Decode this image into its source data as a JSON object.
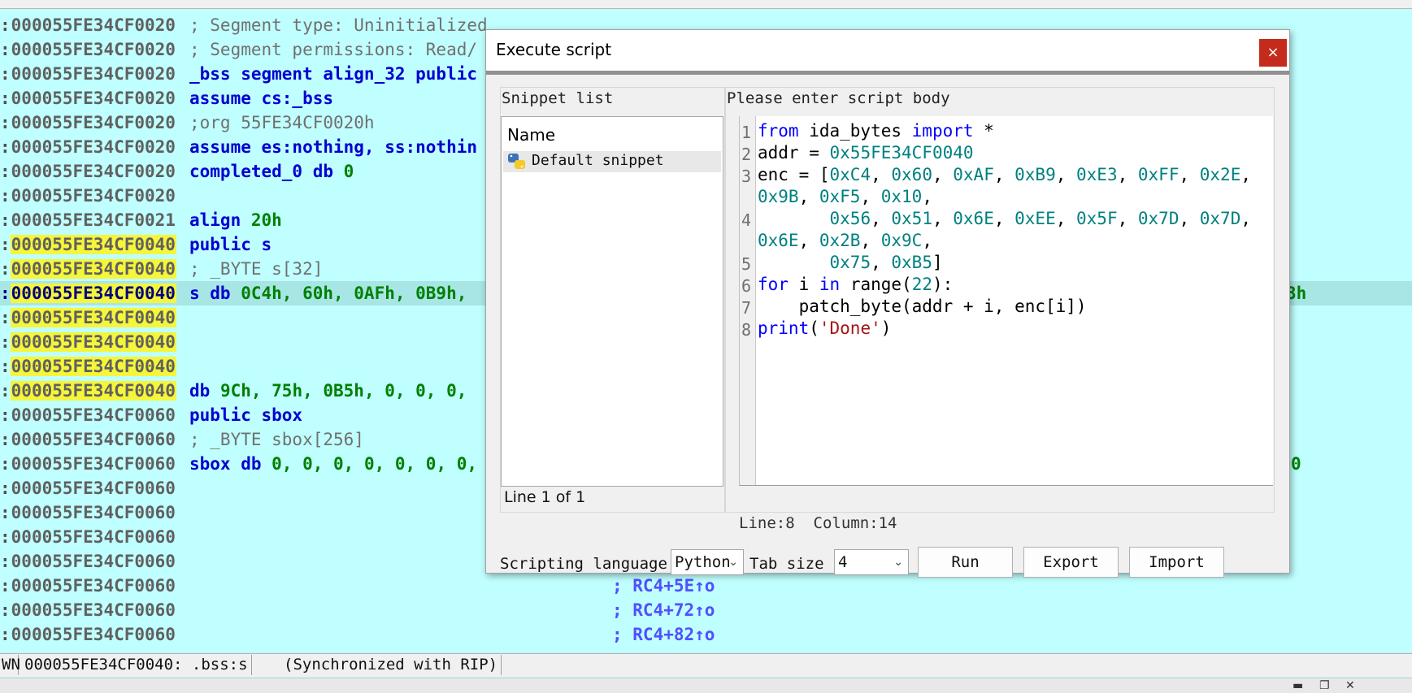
{
  "disasm": {
    "lines": [
      {
        "addr": "000055FE34CF0020",
        "code": "; Segment type: Uninitialized"
      },
      {
        "addr": "000055FE34CF0020",
        "code": "; Segment permissions: Read/"
      },
      {
        "addr": "000055FE34CF0020",
        "code": "_bss segment align_32 public"
      },
      {
        "addr": "000055FE34CF0020",
        "code": "assume cs:_bss"
      },
      {
        "addr": "000055FE34CF0020",
        "code": ";org 55FE34CF0020h"
      },
      {
        "addr": "000055FE34CF0020",
        "code": "assume es:nothing, ss:nothin"
      },
      {
        "addr": "000055FE34CF0020",
        "code_a": "completed_0 db ",
        "code_b": "0"
      },
      {
        "addr": "000055FE34CF0020",
        "code": ""
      },
      {
        "addr": "000055FE34CF0021",
        "code_a": "align ",
        "code_b": "20h"
      },
      {
        "addr": "000055FE34CF0040",
        "code": "public s"
      },
      {
        "addr": "000055FE34CF0040",
        "code": "; _BYTE s[32]"
      },
      {
        "addr": "000055FE34CF0040",
        "code_a": "s db ",
        "code_b": "0C4h, 60h, 0AFh, 0B9h,",
        "tail": "3h"
      },
      {
        "addr": "000055FE34CF0040",
        "code": ""
      },
      {
        "addr": "000055FE34CF0040",
        "code": ""
      },
      {
        "addr": "000055FE34CF0040",
        "code": ""
      },
      {
        "addr": "000055FE34CF0040",
        "code_a": "db ",
        "code_b": "9Ch, 75h, 0B5h, 0, 0, 0,"
      },
      {
        "addr": "000055FE34CF0060",
        "code": "public sbox"
      },
      {
        "addr": "000055FE34CF0060",
        "code": "; _BYTE sbox[256]"
      },
      {
        "addr": "000055FE34CF0060",
        "code_a": "sbox db ",
        "code_b": "0, 0, 0, 0, 0, 0, 0,",
        "tail": "0"
      },
      {
        "addr": "000055FE34CF0060",
        "code": ""
      },
      {
        "addr": "000055FE34CF0060",
        "code": ""
      },
      {
        "addr": "000055FE34CF0060",
        "code": ""
      },
      {
        "addr": "000055FE34CF0060",
        "code": ""
      },
      {
        "addr": "000055FE34CF0060",
        "xref": "; RC4+5E↑o"
      },
      {
        "addr": "000055FE34CF0060",
        "xref": "; RC4+72↑o"
      },
      {
        "addr": "000055FE34CF0060",
        "xref": "; RC4+82↑o"
      }
    ]
  },
  "status": {
    "mode": "WN",
    "location": "000055FE34CF0040: .bss:s",
    "sync": "(Synchronized with RIP)"
  },
  "dialog": {
    "title": "Execute script",
    "close_glyph": "×",
    "snippet_list_label": "Snippet list",
    "snippet_header": "Name",
    "snippet_item": "Default snippet",
    "snippet_line_info": "Line 1 of 1",
    "script_body_label": "Please enter script body",
    "line_numbers": [
      "1",
      "2",
      "3",
      "4",
      "5",
      "6",
      "7",
      "8"
    ],
    "cursor_pos": "Line:8  Column:14",
    "language_label": "Scripting language",
    "language_value": "Python",
    "tabsize_label": "Tab size",
    "tabsize_value": "4",
    "run_label": "Run",
    "export_label": "Export",
    "import_label": "Import"
  },
  "script": {
    "l1": {
      "kw1": "from",
      "t1": " ida_bytes ",
      "kw2": "import",
      "t2": " *"
    },
    "l2": {
      "t1": "addr = ",
      "n1": "0x55FE34CF0040"
    },
    "l3a": "enc = [",
    "l3b": "0xC4",
    "l3c": "0x60",
    "l3d": "0xAF",
    "l3e": "0xB9",
    "l3f": "0xE3",
    "l3g": "0xFF",
    "l3h": "0x2E",
    "l3i": "0x9B",
    "l3j": "0xF5",
    "l3k": "0x10",
    "l4a": "0x56",
    "l4b": "0x51",
    "l4c": "0x6E",
    "l4d": "0xEE",
    "l4e": "0x5F",
    "l4f": "0x7D",
    "l4g": "0x7D",
    "l4h": "0x6E",
    "l4i": "0x2B",
    "l4j": "0x9C",
    "l5a": "0x75",
    "l5b": "0xB5",
    "l6": {
      "kw1": "for",
      "t1": " i ",
      "kw2": "in",
      "t2": " range(",
      "n1": "22",
      "t3": "):"
    },
    "l7": "    patch_byte(addr + i, enc[i])",
    "l8": {
      "kw1": "print",
      "t1": "(",
      "s1": "'Done'",
      "t2": ")"
    }
  }
}
